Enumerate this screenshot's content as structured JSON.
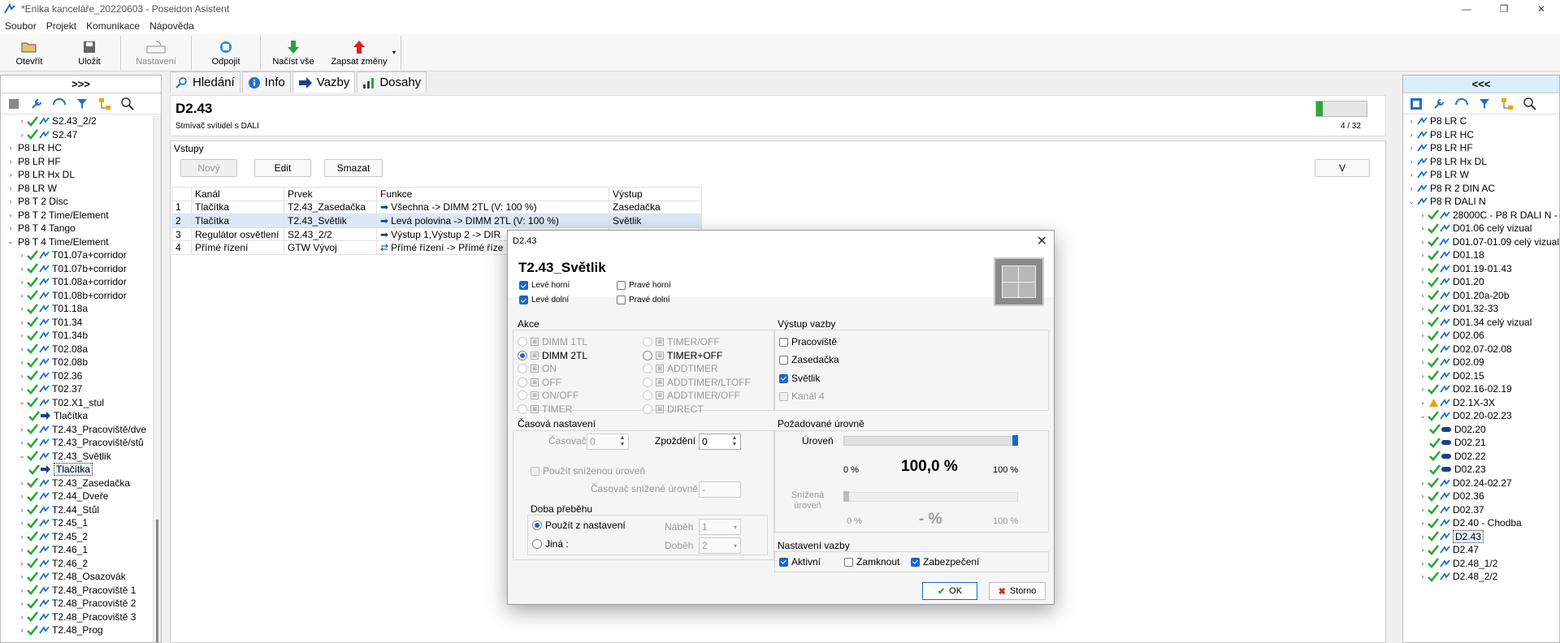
{
  "window": {
    "title": "*Enika kanceláře_20220603 - Poseidon Asistent"
  },
  "menu": [
    "Soubor",
    "Projekt",
    "Komunikace",
    "Nápověda"
  ],
  "toolbar": {
    "open": "Otevřít",
    "save": "Uložit",
    "settings": "Nastavení",
    "disconnect": "Odpojit",
    "load_all": "Načíst vše",
    "write_changes": "Zapsat změny"
  },
  "left_panel": {
    "toggle": ">>>",
    "items": [
      {
        "t": "S2.43_2/2"
      },
      {
        "t": "S2.47"
      },
      {
        "t": "P8 LR HC"
      },
      {
        "t": "P8 LR HF"
      },
      {
        "t": "P8 LR Hx DL"
      },
      {
        "t": "P8 LR W"
      },
      {
        "t": "P8 T 2 Disc"
      },
      {
        "t": "P8 T 2 Time/Element"
      },
      {
        "t": "P8 T 4 Tango"
      },
      {
        "t": "P8 T 4 Time/Element"
      },
      {
        "t": "T01.07a+corridor"
      },
      {
        "t": "T01.07b+corridor"
      },
      {
        "t": "T01.08a+corridor"
      },
      {
        "t": "T01.08b+corridor"
      },
      {
        "t": "T01.18a"
      },
      {
        "t": "T01.34"
      },
      {
        "t": "T01.34b"
      },
      {
        "t": "T02.08a"
      },
      {
        "t": "T02.08b"
      },
      {
        "t": "T02.36"
      },
      {
        "t": "T02.37"
      },
      {
        "t": "T02.X1_stul"
      },
      {
        "t": "Tlačítka"
      },
      {
        "t": "T2.43_Pracoviště/dve"
      },
      {
        "t": "T2.43_Pracoviště/stů"
      },
      {
        "t": "T2.43_Světlik"
      },
      {
        "t": "Tlačítka"
      },
      {
        "t": "T2.43_Zasedačka"
      },
      {
        "t": "T2.44_Dveře"
      },
      {
        "t": "T2.44_Stůl"
      },
      {
        "t": "T2.45_1"
      },
      {
        "t": "T2.45_2"
      },
      {
        "t": "T2.46_1"
      },
      {
        "t": "T2.46_2"
      },
      {
        "t": "T2.48_Osazovák"
      },
      {
        "t": "T2.48_Pracoviště 1"
      },
      {
        "t": "T2.48_Pracoviště 2"
      },
      {
        "t": "T2.48_Pracoviště 3"
      },
      {
        "t": "T2.48_Prog"
      }
    ]
  },
  "right_panel": {
    "toggle": "<<<",
    "items": [
      {
        "t": "P8 LR C"
      },
      {
        "t": "P8 LR HC"
      },
      {
        "t": "P8 LR HF"
      },
      {
        "t": "P8 LR Hx DL"
      },
      {
        "t": "P8 LR W"
      },
      {
        "t": "P8 R 2 DIN AC"
      },
      {
        "t": "P8 R DALI N"
      },
      {
        "t": "28000C - P8 R DALI N -"
      },
      {
        "t": "D01.06 celý vizual"
      },
      {
        "t": "D01.07-01.09 celý vizual"
      },
      {
        "t": "D01.18"
      },
      {
        "t": "D01.19-01.43"
      },
      {
        "t": "D01.20"
      },
      {
        "t": "D01.20a-20b"
      },
      {
        "t": "D01.32-33"
      },
      {
        "t": "D01.34 celý vizual"
      },
      {
        "t": "D02.06"
      },
      {
        "t": "D02.07-02.08"
      },
      {
        "t": "D02.09"
      },
      {
        "t": "D02.15"
      },
      {
        "t": "D02.16-02.19"
      },
      {
        "t": "D2.1X-3X"
      },
      {
        "t": "D02.20-02.23"
      },
      {
        "t": "D02.20"
      },
      {
        "t": "D02.21"
      },
      {
        "t": "D02.22"
      },
      {
        "t": "D02.23"
      },
      {
        "t": "D02.24-02.27"
      },
      {
        "t": "D02.36"
      },
      {
        "t": "D02.37"
      },
      {
        "t": "D2.40 - Chodba"
      },
      {
        "t": "D2.43"
      },
      {
        "t": "D2.47"
      },
      {
        "t": "D2.48_1/2"
      },
      {
        "t": "D2.48_2/2"
      }
    ]
  },
  "tabs": [
    "Hledání",
    "Info",
    "Vazby",
    "Dosahy"
  ],
  "device": {
    "name": "D2.43",
    "description": "Stmívač svítidel s DALI",
    "progress": 0.125,
    "counter": "4 / 32"
  },
  "inputs": {
    "label": "Vstupy",
    "new": "Nový",
    "edit": "Edit",
    "delete": "Smazat",
    "v": "V",
    "columns": [
      "Kanál",
      "Prvek",
      "Funkce",
      "Výstup"
    ],
    "rows": [
      [
        "1",
        "Tlačítka",
        "T2.43_Zasedačka",
        "Všechna -> DIMM 2TL (V: 100 %)",
        "Zasedačka"
      ],
      [
        "2",
        "Tlačítka",
        "T2.43_Světlik",
        "Levá polovina -> DIMM 2TL (V: 100 %)",
        "Světlik"
      ],
      [
        "3",
        "Regulátor osvětlení",
        "S2.43_2/2",
        "Výstup 1,Výstup 2 -> DIR",
        ""
      ],
      [
        "4",
        "Přímé řízení",
        "GTW Vývoj",
        "Přímé řízení -> Přímé říze",
        ""
      ]
    ]
  },
  "dialog": {
    "title": "D2.43",
    "name": "T2.43_Světlik",
    "buttons_pos": {
      "lh": "Levé horní",
      "rh": "Pravé horní",
      "ld": "Levé dolní",
      "rd": "Pravé dolní"
    },
    "akce_label": "Akce",
    "actions_left": [
      "DIMM 1TL",
      "DIMM 2TL",
      "ON",
      "OFF",
      "ON/OFF",
      "TIMER"
    ],
    "actions_right": [
      "TIMER/OFF",
      "TIMER+OFF",
      "ADDTIMER",
      "ADDTIMER/LTOFF",
      "ADDTIMER/OFF",
      "DIRECT"
    ],
    "output_label": "Výstup vazby",
    "outputs": [
      "Pracoviště",
      "Zasedačka",
      "Světlik",
      "Kanál 4"
    ],
    "timing_label": "Časová nastavení",
    "timer_label": "Časovač",
    "timer_value": "0",
    "delay_label": "Zpoždění",
    "delay_value": "0",
    "reduced_use": "Použít sníženou úroveň",
    "reduced_timer": "Časovač snížené úrovně",
    "reduced_timer_value": "-",
    "ramp_label": "Doba přeběhu",
    "ramp_use": "Použít z nastavení",
    "ramp_other": "Jiná :",
    "ramp_up": "Náběh",
    "ramp_up_v": "1",
    "ramp_down": "Doběh",
    "ramp_down_v": "2",
    "level_label": "Požadované úrovně",
    "level": "Úroveň",
    "level_value": "100,0 %",
    "level_min": "0 %",
    "level_max": "100 %",
    "level_fraction": 1.0,
    "reduced_level": "Snížená úroveň",
    "reduced_value": "- %",
    "reduced_min": "0 %",
    "reduced_max": "100 %",
    "binding_label": "Nastavení vazby",
    "active": "Aktivní",
    "lock": "Zamknout",
    "secure": "Zabezpečení",
    "ok": "OK",
    "cancel": "Storno"
  },
  "colors": {
    "accent": "#1967c6",
    "check_green": "#2aa836"
  }
}
